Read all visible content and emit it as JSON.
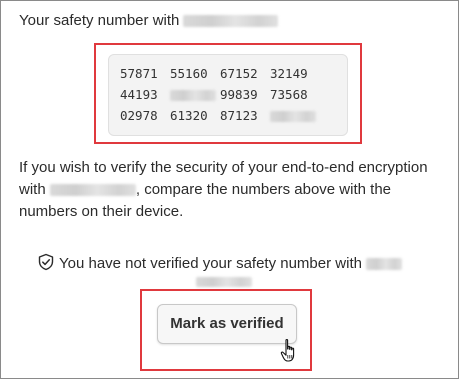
{
  "header": {
    "safety_title": "Your safety number with"
  },
  "safety_number": {
    "rows": [
      [
        "57871",
        "55160",
        "67152",
        "32149"
      ],
      [
        "44193",
        "",
        "99839",
        "73568"
      ],
      [
        "02978",
        "61320",
        "87123",
        ""
      ]
    ]
  },
  "explanation": {
    "part1": "If you wish to verify the security of your end-to-end encryption with",
    "part2": ", compare the numbers above with the numbers on their device."
  },
  "status": {
    "icon": "shield-check-icon",
    "text": "You have not verified your safety number with"
  },
  "actions": {
    "mark_verified_label": "Mark as verified"
  },
  "colors": {
    "highlight": "#e0393e",
    "number_box_bg": "#f3f3f3"
  }
}
